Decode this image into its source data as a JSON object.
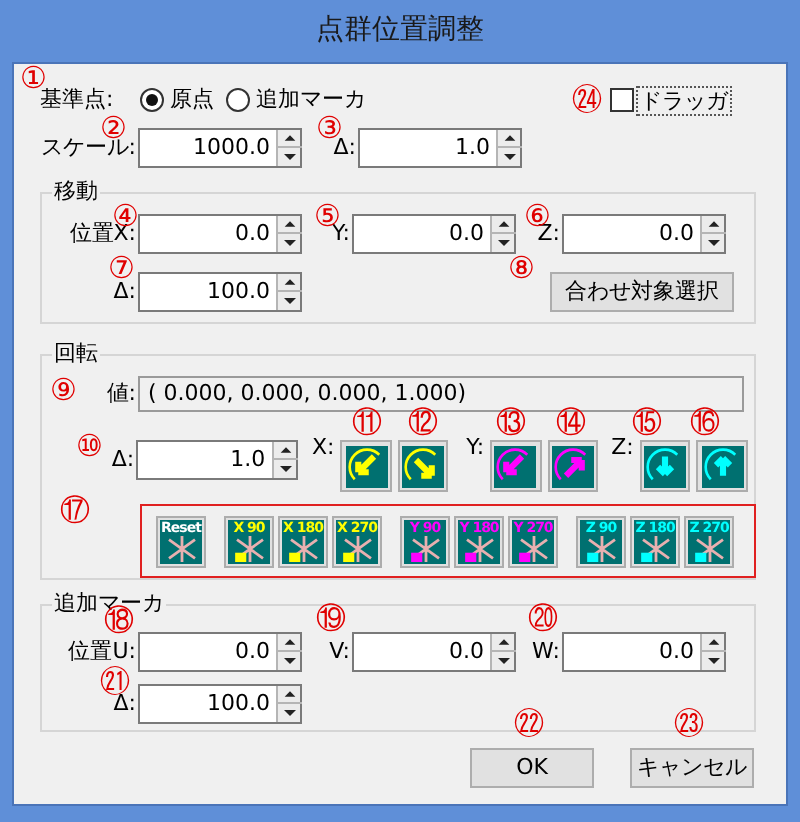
{
  "window": {
    "title": "点群位置調整"
  },
  "reference": {
    "label": "基準点:",
    "options": [
      {
        "label": "原点",
        "selected": true
      },
      {
        "label": "追加マーカ",
        "selected": false
      }
    ]
  },
  "dragger": {
    "label": "ドラッガ",
    "checked": false
  },
  "scale": {
    "label": "スケール:",
    "value": "1000.0"
  },
  "scale_delta": {
    "label": "Δ:",
    "value": "1.0"
  },
  "move": {
    "title": "移動",
    "fields": [
      {
        "label": "位置X:",
        "value": "0.0"
      },
      {
        "label": "Y:",
        "value": "0.0"
      },
      {
        "label": "Z:",
        "value": "0.0"
      }
    ],
    "delta": {
      "label": "Δ:",
      "value": "100.0"
    },
    "button": "合わせ対象選択"
  },
  "rotation": {
    "title": "回転",
    "value_label": "値:",
    "value": "( 0.000, 0.000, 0.000, 1.000)",
    "delta": {
      "label": "Δ:",
      "value": "1.0"
    },
    "axes": [
      {
        "label": "X:",
        "color": "#ffff00"
      },
      {
        "label": "Y:",
        "color": "#ff00ff"
      },
      {
        "label": "Z:",
        "color": "#00ffff"
      }
    ],
    "presets": [
      [
        {
          "label": "Reset",
          "kind": "reset"
        }
      ],
      [
        {
          "label": "X 90",
          "color": "#ffff00"
        },
        {
          "label": "X 180",
          "color": "#ffff00"
        },
        {
          "label": "X 270",
          "color": "#ffff00"
        }
      ],
      [
        {
          "label": "Y 90",
          "color": "#ff00ff"
        },
        {
          "label": "Y 180",
          "color": "#ff00ff"
        },
        {
          "label": "Y 270",
          "color": "#ff00ff"
        }
      ],
      [
        {
          "label": "Z 90",
          "color": "#00ffff"
        },
        {
          "label": "Z 180",
          "color": "#00ffff"
        },
        {
          "label": "Z 270",
          "color": "#00ffff"
        }
      ]
    ]
  },
  "marker": {
    "title": "追加マーカ",
    "fields": [
      {
        "label": "位置U:",
        "value": "0.0"
      },
      {
        "label": "V:",
        "value": "0.0"
      },
      {
        "label": "W:",
        "value": "0.0"
      }
    ],
    "delta": {
      "label": "Δ:",
      "value": "100.0"
    }
  },
  "buttons": [
    "OK",
    "キャンセル"
  ],
  "annotations": [
    "①",
    "②",
    "③",
    "④",
    "⑤",
    "⑥",
    "⑦",
    "⑧",
    "⑨",
    "⑩",
    "⑪",
    "⑫",
    "⑬",
    "⑭",
    "⑮",
    "⑯",
    "⑰",
    "⑱",
    "⑲",
    "⑳",
    "㉑",
    "㉒",
    "㉓",
    "㉔"
  ]
}
